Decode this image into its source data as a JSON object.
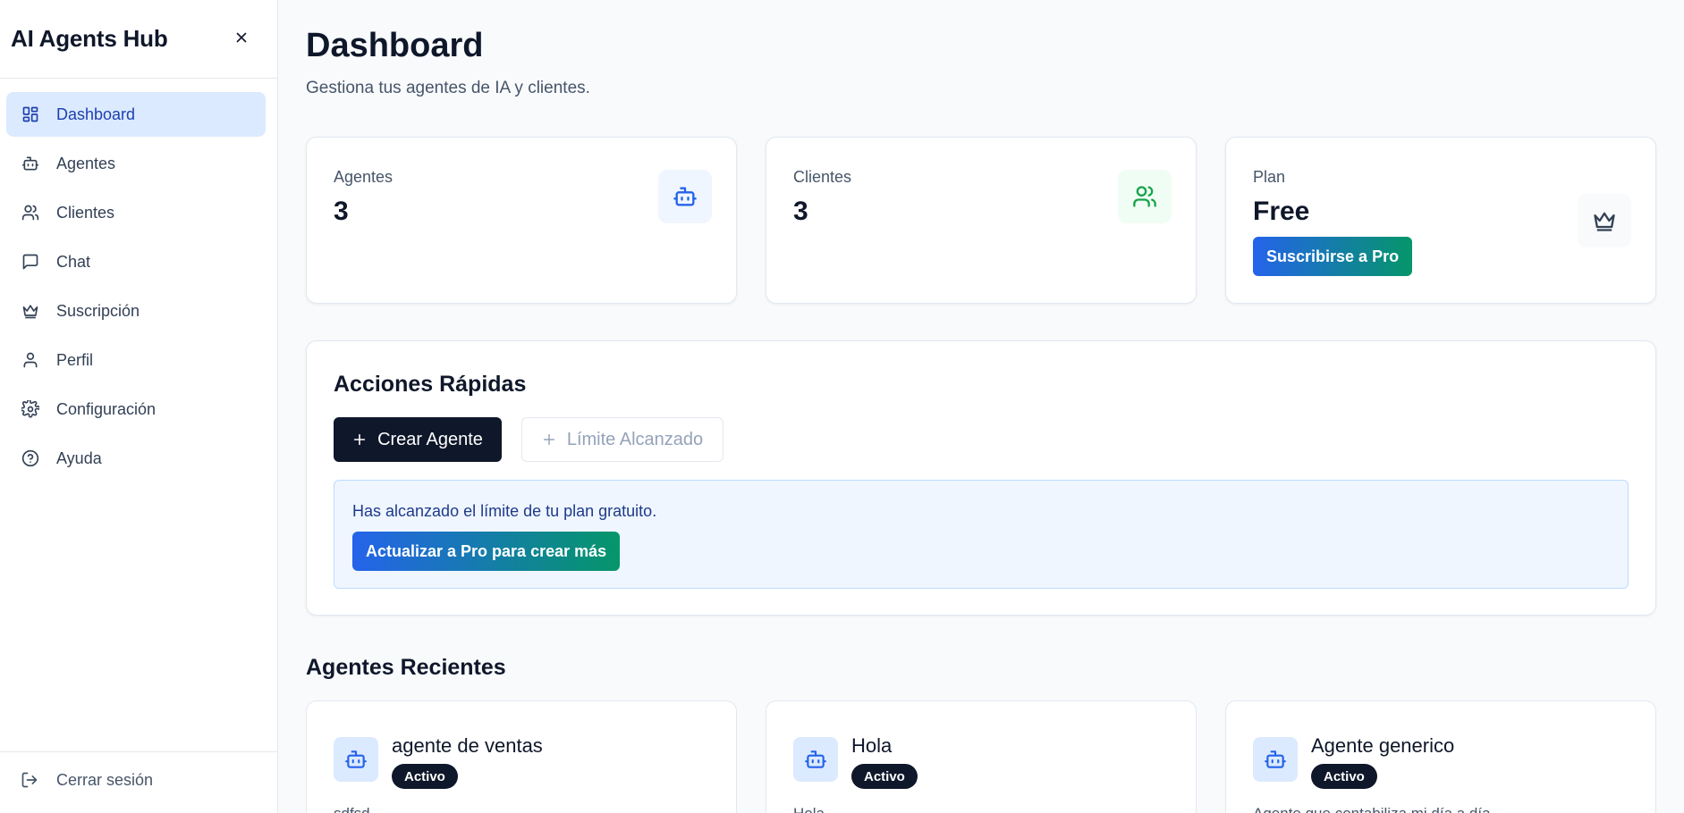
{
  "sidebar": {
    "brand": "AI Agents Hub",
    "items": [
      {
        "label": "Dashboard",
        "icon": "layout-dashboard-icon",
        "active": true
      },
      {
        "label": "Agentes",
        "icon": "bot-icon"
      },
      {
        "label": "Clientes",
        "icon": "users-icon"
      },
      {
        "label": "Chat",
        "icon": "message-square-icon"
      },
      {
        "label": "Suscripción",
        "icon": "crown-icon"
      },
      {
        "label": "Perfil",
        "icon": "user-icon"
      },
      {
        "label": "Configuración",
        "icon": "gear-icon"
      },
      {
        "label": "Ayuda",
        "icon": "help-circle-icon"
      }
    ],
    "logout_label": "Cerrar sesión"
  },
  "header": {
    "title": "Dashboard",
    "subtitle": "Gestiona tus agentes de IA y clientes."
  },
  "stats": {
    "agents": {
      "label": "Agentes",
      "value": "3"
    },
    "clients": {
      "label": "Clientes",
      "value": "3"
    },
    "plan": {
      "label": "Plan",
      "value": "Free",
      "button": "Suscribirse a Pro"
    }
  },
  "quick_actions": {
    "title": "Acciones Rápidas",
    "create_label": "Crear Agente",
    "limit_label": "Límite Alcanzado",
    "limit_message": "Has alcanzado el límite de tu plan gratuito.",
    "upgrade_label": "Actualizar a Pro para crear más"
  },
  "recent": {
    "title": "Agentes Recientes",
    "agents": [
      {
        "name": "agente de ventas",
        "status": "Activo",
        "description": "sdfsd"
      },
      {
        "name": "Hola",
        "status": "Activo",
        "description": "Hola"
      },
      {
        "name": "Agente generico",
        "status": "Activo",
        "description": "Agente que contabiliza mi día a día"
      }
    ]
  },
  "colors": {
    "accent": "#2563eb",
    "active_bg": "#dbeafe",
    "dark": "#0f172a",
    "green": "#16a34a"
  }
}
